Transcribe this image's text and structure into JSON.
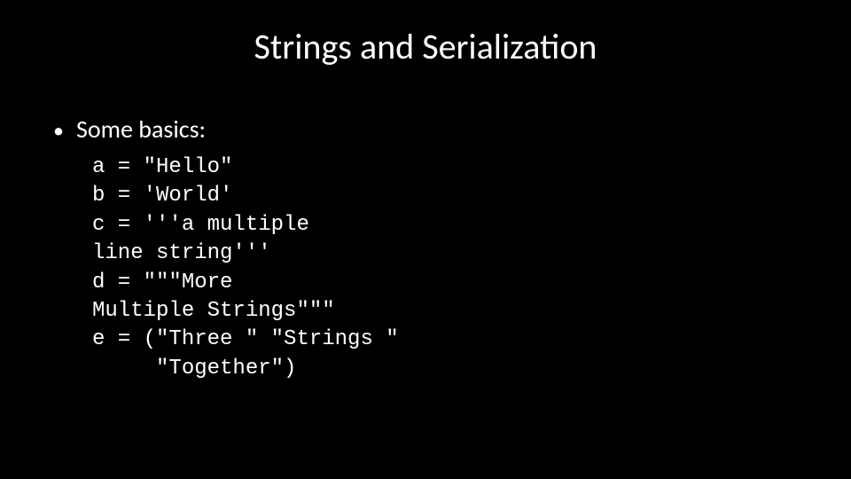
{
  "title": "Strings and Serialization",
  "bullet": {
    "dot": "•",
    "text": "Some basics:"
  },
  "code": "a = \"Hello\"\nb = 'World'\nc = '''a multiple\nline string'''\nd = \"\"\"More\nMultiple Strings\"\"\"\ne = (\"Three \" \"Strings \"\n     \"Together\")"
}
